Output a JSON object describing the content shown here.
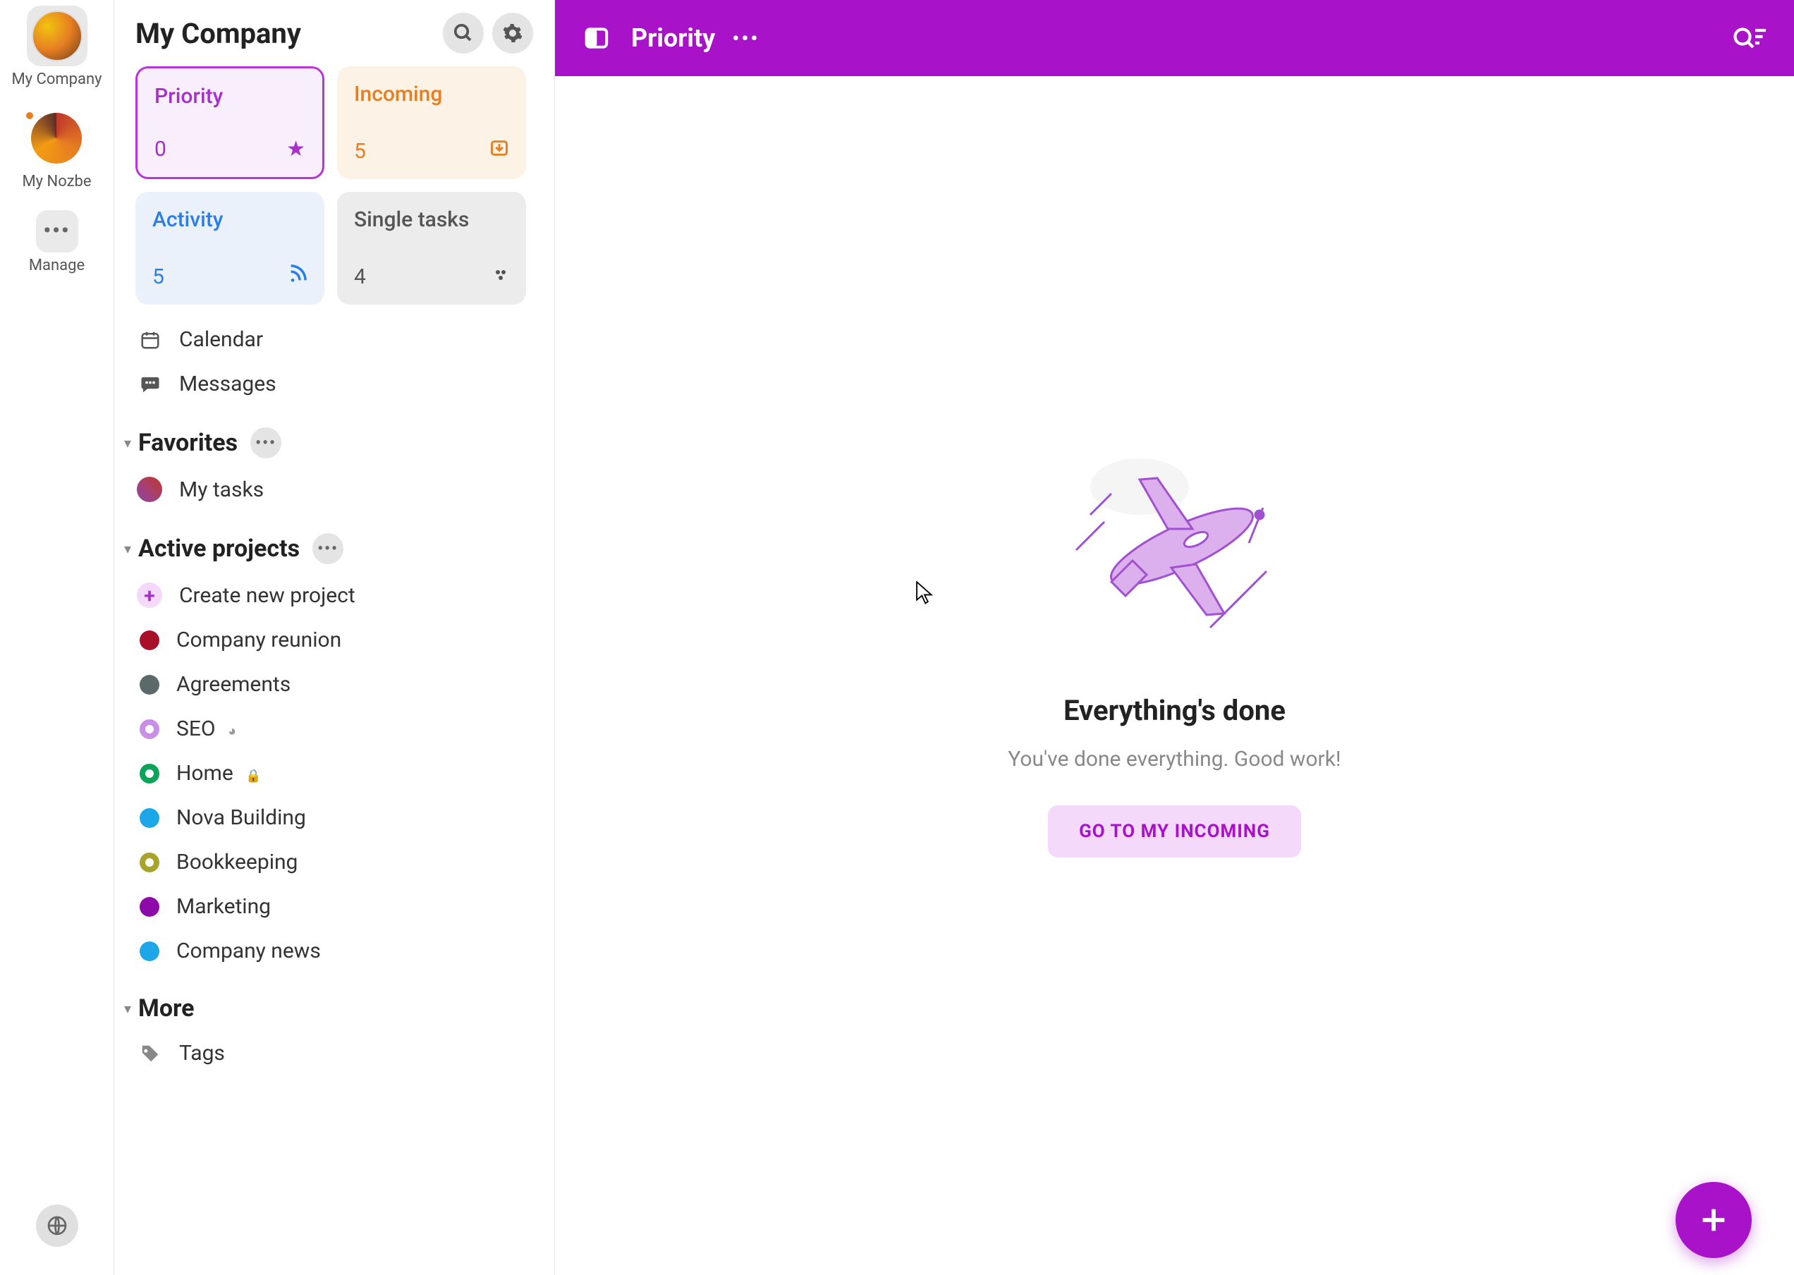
{
  "rail": {
    "workspaces": [
      {
        "label": "My Company",
        "active": true
      },
      {
        "label": "My Nozbe",
        "active": false,
        "hasIndicator": true
      }
    ],
    "manage_label": "Manage"
  },
  "sidebar": {
    "title": "My Company",
    "cards": {
      "priority": {
        "title": "Priority",
        "count": "0"
      },
      "incoming": {
        "title": "Incoming",
        "count": "5"
      },
      "activity": {
        "title": "Activity",
        "count": "5"
      },
      "single": {
        "title": "Single tasks",
        "count": "4"
      }
    },
    "quick": {
      "calendar": "Calendar",
      "messages": "Messages"
    },
    "favorites_title": "Favorites",
    "favorites": [
      {
        "label": "My tasks"
      }
    ],
    "active_projects_title": "Active projects",
    "create_project_label": "Create new project",
    "projects": [
      {
        "label": "Company reunion",
        "color": "#a8102a"
      },
      {
        "label": "Agreements",
        "color": "#5a6a6a"
      },
      {
        "label": "SEO",
        "color": "#c98fe6",
        "shared": true,
        "ring": true
      },
      {
        "label": "Home",
        "color": "#0aa35a",
        "locked": true,
        "ring": true
      },
      {
        "label": "Nova Building",
        "color": "#1ea7e8"
      },
      {
        "label": "Bookkeeping",
        "color": "#a8a32a",
        "ring": true
      },
      {
        "label": "Marketing",
        "color": "#8e0aa8"
      },
      {
        "label": "Company news",
        "color": "#1ea7e8"
      }
    ],
    "more_title": "More",
    "tags_label": "Tags"
  },
  "topbar": {
    "title": "Priority"
  },
  "empty": {
    "title": "Everything's done",
    "subtitle": "You've done everything. Good work!",
    "button": "GO TO MY INCOMING"
  }
}
